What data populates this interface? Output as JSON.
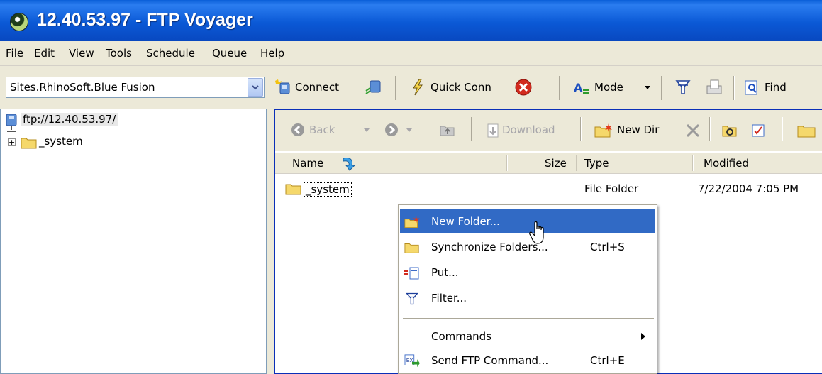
{
  "window": {
    "title": "12.40.53.97 - FTP Voyager"
  },
  "menubar": {
    "items": [
      "File",
      "Edit",
      "View",
      "Tools",
      "Schedule",
      "Queue",
      "Help"
    ]
  },
  "toolbar": {
    "site_value": "Sites.RhinoSoft.Blue Fusion",
    "connect_label": "Connect",
    "quick_conn_label": "Quick Conn",
    "mode_label": "Mode",
    "find_label": "Find"
  },
  "tree": {
    "root": "ftp://12.40.53.97/",
    "child": "_system"
  },
  "remote_toolbar": {
    "back_label": "Back",
    "download_label": "Download",
    "new_dir_label": "New Dir"
  },
  "list": {
    "columns": {
      "name": "Name",
      "size": "Size",
      "type": "Type",
      "modified": "Modified"
    },
    "rows": [
      {
        "name": "_system",
        "size": "",
        "type": "File Folder",
        "modified": "7/22/2004 7:05 PM"
      }
    ]
  },
  "context_menu": {
    "items": [
      {
        "label": "New Folder...",
        "shortcut": "",
        "highlighted": true
      },
      {
        "label": "Synchronize Folders...",
        "shortcut": "Ctrl+S"
      },
      {
        "label": "Put...",
        "shortcut": ""
      },
      {
        "label": "Filter...",
        "shortcut": ""
      },
      {
        "label": "Commands",
        "shortcut": "",
        "submenu": true
      },
      {
        "label": "Send FTP Command...",
        "shortcut": "Ctrl+E"
      }
    ]
  },
  "colors": {
    "title_bar": "#0a5fd8",
    "highlight": "#316ac5",
    "folder": "#f5d86b",
    "active_border": "#0a2fb8"
  }
}
